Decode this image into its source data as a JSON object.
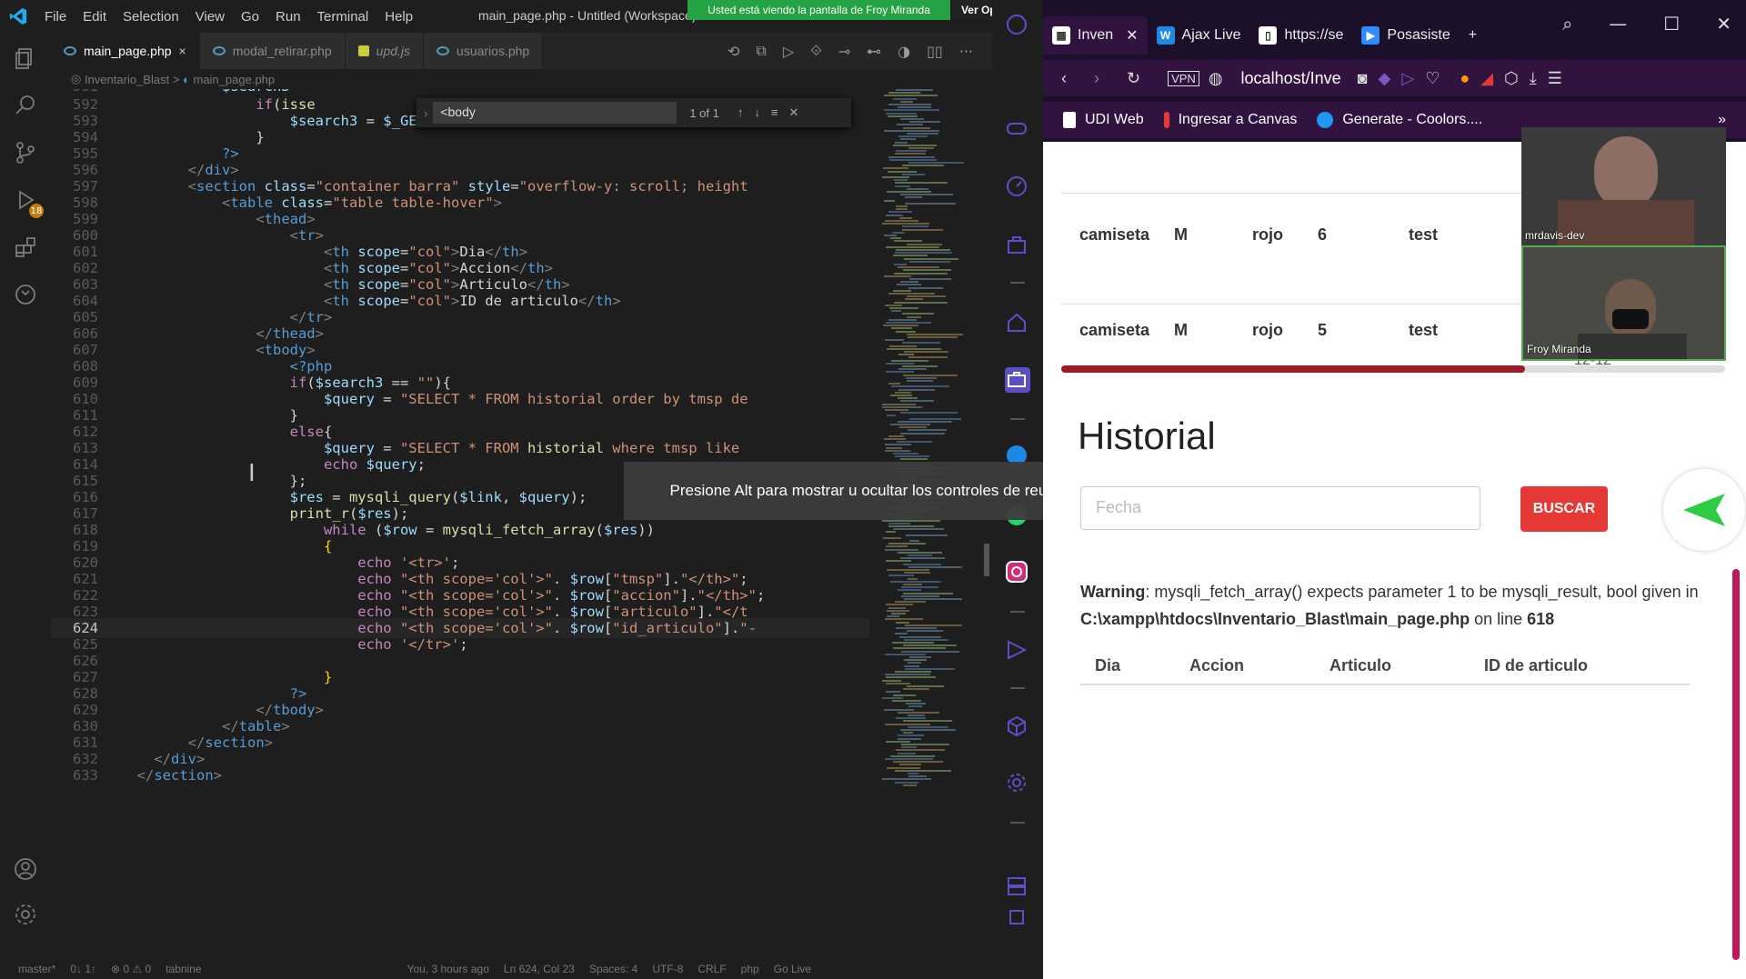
{
  "vscode": {
    "menu": [
      "File",
      "Edit",
      "Selection",
      "View",
      "Go",
      "Run",
      "Terminal",
      "Help"
    ],
    "window_title": "main_page.php - Untitled (Workspace)",
    "share_banner": "Usted está viendo la pantalla de Froy Miranda",
    "share_options": "Ver Opciones",
    "tabs": [
      {
        "label": "main_page.php",
        "close": "×"
      },
      {
        "label": "modal_retirar.php"
      },
      {
        "label": "upd.js"
      },
      {
        "label": "usuarios.php"
      }
    ],
    "breadcrumb": {
      "folder": "Inventario_Blast",
      "file": "main_page.php"
    },
    "find": {
      "query": "<body",
      "count": "1 of 1"
    },
    "source_control_badge": "18",
    "status": {
      "branch": "master*",
      "sync": "0↓ 1↑",
      "problems": "⊗ 0 ⚠ 0",
      "tabnine": "tabnine",
      "blame": "You, 3 hours ago",
      "position": "Ln 624, Col 23",
      "spaces": "Spaces: 4",
      "encoding": "UTF-8",
      "eol": "CRLF",
      "lang": "php",
      "golive": "Go Live"
    }
  },
  "meeting_tooltip": "Presione Alt para mostrar u ocultar los controles de reunión",
  "browser": {
    "tabs": [
      "Inven",
      "Ajax Live",
      "https://se",
      "Posasiste"
    ],
    "new_tab": "+",
    "url": "localhost/Inve",
    "bookmarks": [
      "UDI Web",
      "Ingresar a Canvas",
      "Generate - Coolors...."
    ],
    "page": {
      "rows": [
        {
          "articulo": "camiseta",
          "talla": "M",
          "color": "rojo",
          "cantidad": "6",
          "usuario": "test"
        },
        {
          "articulo": "camiseta",
          "talla": "M",
          "color": "rojo",
          "cantidad": "5",
          "usuario": "test"
        }
      ],
      "partial_date": "12-12",
      "title": "Historial",
      "search_placeholder": "Fecha",
      "search_button": "BUSCAR",
      "warning_label": "Warning",
      "warning_text": ": mysqli_fetch_array() expects parameter 1 to be mysqli_result, bool given in ",
      "warning_path": "C:\\xampp\\htdocs\\Inventario_Blast\\main_page.php",
      "warning_online": " on line ",
      "warning_line": "618",
      "columns": [
        "Dia",
        "Accion",
        "Articulo",
        "ID de articulo"
      ]
    }
  },
  "participants": [
    "mrdavis-dev",
    "Froy Miranda"
  ]
}
